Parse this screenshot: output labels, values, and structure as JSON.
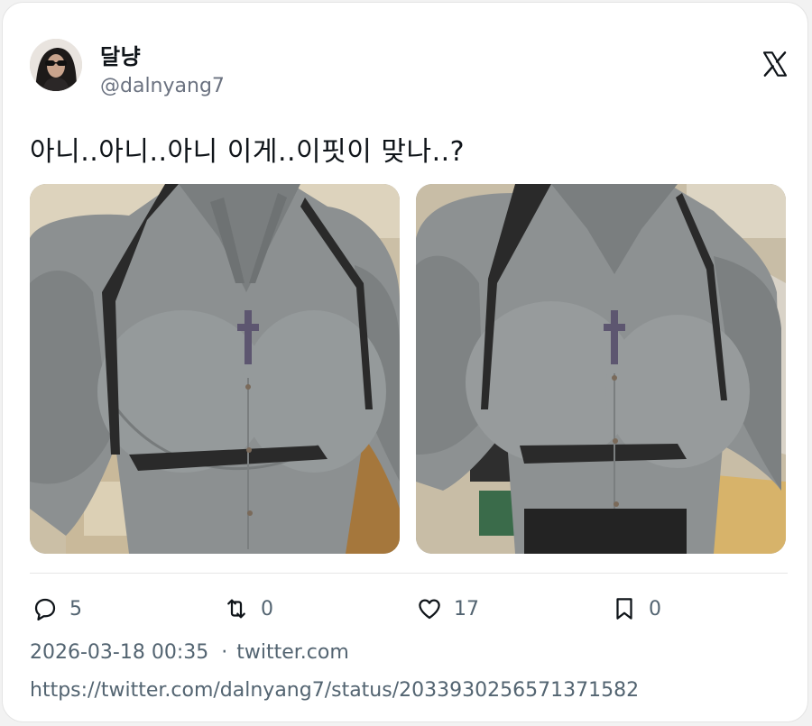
{
  "author": {
    "display_name": "달냥",
    "handle": "@dalnyang7"
  },
  "tweet": {
    "text": "아니..아니..아니 이게..이핏이 맞나..?"
  },
  "icons": {
    "brand": "x-logo-icon",
    "reply": "reply-icon",
    "retweet": "retweet-icon",
    "like": "heart-icon",
    "bookmark": "bookmark-icon"
  },
  "actions": {
    "replies": "5",
    "retweets": "0",
    "likes": "17",
    "bookmarks": "0"
  },
  "meta": {
    "timestamp": "2026-03-18 00:35",
    "separator": "·",
    "source": "twitter.com",
    "url": "https://twitter.com/dalnyang7/status/2033930256571371582"
  },
  "colors": {
    "text_primary": "#0f1419",
    "text_secondary": "#536471",
    "shirt": "#8e9293"
  }
}
